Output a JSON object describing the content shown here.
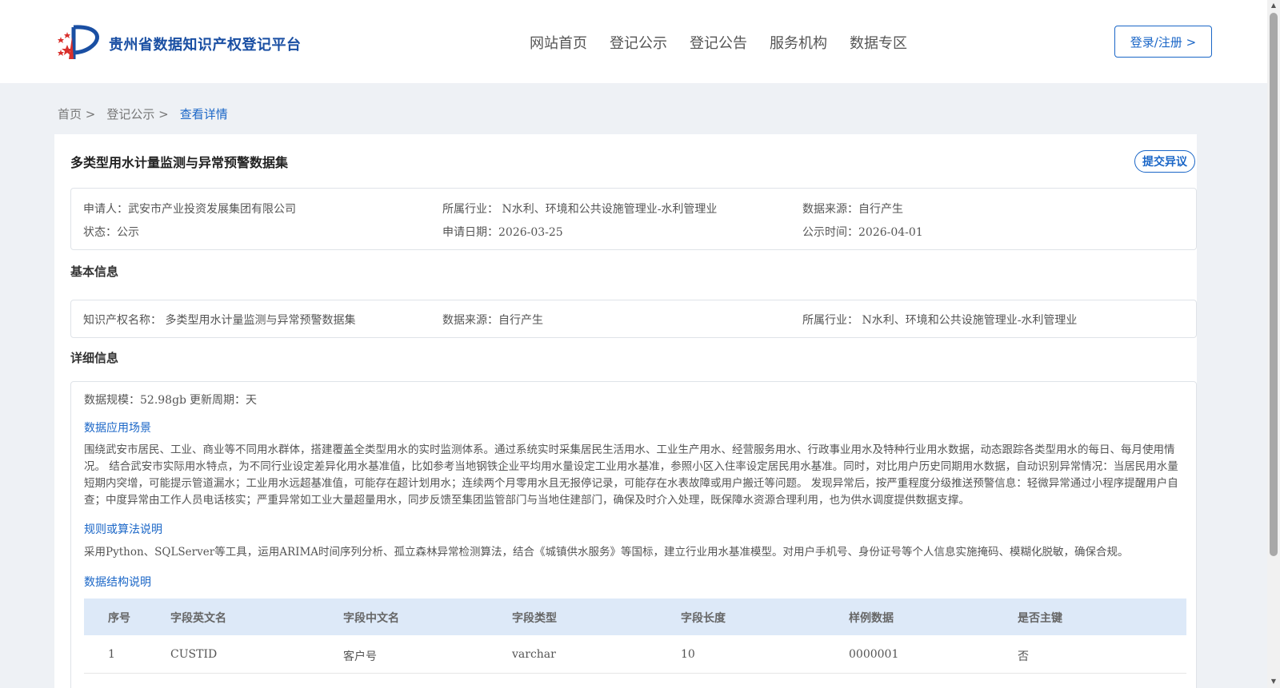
{
  "header": {
    "site_title": "贵州省数据知识产权登记平台",
    "nav": [
      "网站首页",
      "登记公示",
      "登记公告",
      "服务机构",
      "数据专区"
    ],
    "login_label": "登录/注册 >"
  },
  "breadcrumb": {
    "home": "首页 >",
    "list": "登记公示 >",
    "current": "查看详情"
  },
  "record": {
    "title": "多类型用水计量监测与异常预警数据集",
    "dispute_label": "提交异议",
    "applicant": "申请人：武安市产业投资发展集团有限公司",
    "industry": "所属行业： N水利、环境和公共设施管理业-水利管理业",
    "source": "数据来源：自行产生",
    "status": "状态：公示",
    "apply_date": "申请日期：2026-03-25",
    "publish_time": "公示时间：2026-04-01"
  },
  "basic": {
    "section_title": "基本信息",
    "ip_name": "知识产权名称： 多类型用水计量监测与异常预警数据集",
    "source": "数据来源：自行产生",
    "industry": "所属行业： N水利、环境和公共设施管理业-水利管理业"
  },
  "detail": {
    "section_title": "详细信息",
    "scale": "数据规模：52.98gb",
    "cycle": "更新周期：天",
    "scenario_title": "数据应用场景",
    "scenario_text": "围绕武安市居民、工业、商业等不同用水群体，搭建覆盖全类型用水的实时监测体系。通过系统实时采集居民生活用水、工业生产用水、经营服务用水、行政事业用水及特种行业用水数据，动态跟踪各类型用水的每日、每月使用情况。 结合武安市实际用水特点，为不同行业设定差异化用水基准值，比如参考当地钢铁企业平均用水量设定工业用水基准，参照小区入住率设定居民用水基准。同时，对比用户历史同期用水数据，自动识别异常情况：当居民用水量短期内突增，可能提示管道漏水；工业用水远超基准值，可能存在超计划用水；连续两个月零用水且无报停记录，可能存在水表故障或用户搬迁等问题。 发现异常后，按严重程度分级推送预警信息：轻微异常通过小程序提醒用户自查；中度异常由工作人员电话核实；严重异常如工业大量超量用水，同步反馈至集团监管部门与当地住建部门，确保及时介入处理，既保障水资源合理利用，也为供水调度提供数据支撑。",
    "rules_title": "规则或算法说明",
    "rules_text": "采用Python、SQLServer等工具，运用ARIMA时间序列分析、孤立森林异常检测算法，结合《城镇供水服务》等国标，建立行业用水基准模型。对用户手机号、身份证号等个人信息实施掩码、模糊化脱敏，确保合规。",
    "structure_title": "数据结构说明",
    "table": {
      "headers": [
        "序号",
        "字段英文名",
        "字段中文名",
        "字段类型",
        "字段长度",
        "样例数据",
        "是否主键"
      ],
      "rows": [
        [
          "1",
          "CUSTID",
          "客户号",
          "varchar",
          "10",
          "0000001",
          "否"
        ]
      ]
    }
  }
}
